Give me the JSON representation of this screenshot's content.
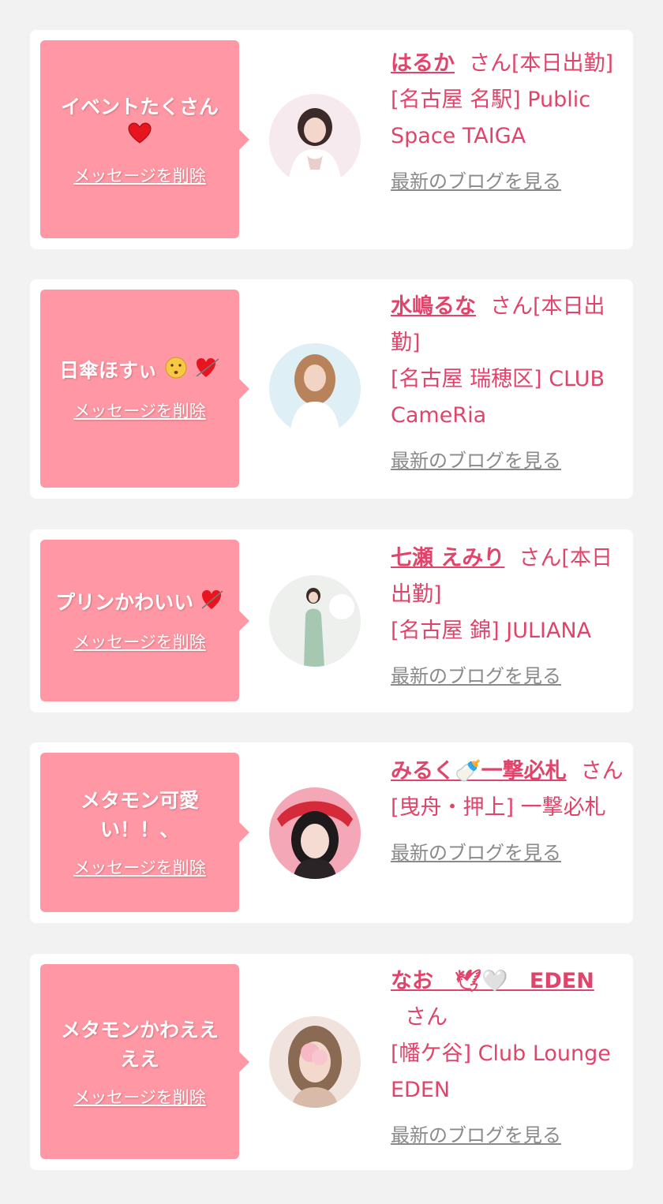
{
  "common": {
    "delete_label": "メッセージを削除",
    "blog_label": "最新のブログを見る"
  },
  "colors": {
    "background": "#f2f2f2",
    "card": "#ffffff",
    "bubble": "#ff98a4",
    "accent_text": "#e0446a",
    "link_gray": "#8a8a8a"
  },
  "messages": [
    {
      "message": "イベントたくさん",
      "message_icon": "heart-emoji",
      "name": "はるか",
      "san_line": "さん[本日出勤]",
      "store": "[名古屋 名駅] Public Space TAIGA"
    },
    {
      "message": "日傘ほすぃ",
      "message_icon": "kissing-face-and-heart-with-arrow-emoji",
      "name": "水嶋るな",
      "san_line": "さん[本日出勤]",
      "store": "[名古屋 瑞穂区] CLUB CameRia"
    },
    {
      "message": "プリンかわいい",
      "message_icon": "heart-with-arrow-emoji",
      "name": "七瀬 えみり",
      "san_line": "さん[本日出勤]",
      "store": "[名古屋 錦] JULIANA"
    },
    {
      "message": "メタモン可愛い！！、",
      "message_icon": "",
      "name": "みるく🍼一撃必札",
      "san_line": "さん",
      "store": "[曳舟・押上] 一撃必札"
    },
    {
      "message": "メタモンかわええええ",
      "message_icon": "",
      "name": "なお　🕊🤍　EDEN",
      "san_line": "さん",
      "store": "[幡ケ谷] Club Lounge EDEN"
    }
  ]
}
